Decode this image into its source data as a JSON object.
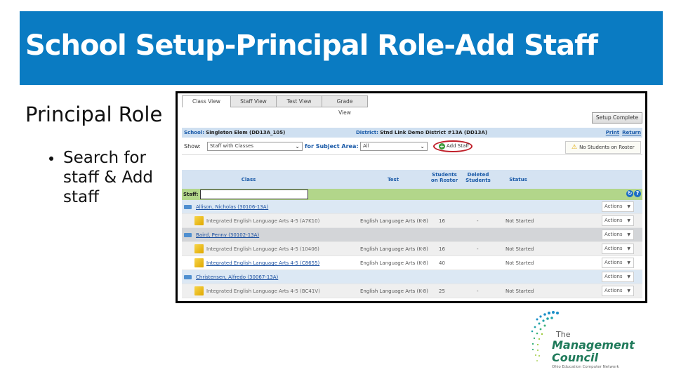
{
  "slide": {
    "title": "School Setup-Principal Role-Add Staff",
    "heading": "Principal Role",
    "bullets": [
      "Search for staff & Add staff"
    ],
    "accent_color": "#0a7bc2"
  },
  "app": {
    "tabs": [
      {
        "label": "Class View",
        "active": true
      },
      {
        "label": "Staff View",
        "active": false
      },
      {
        "label": "Test View",
        "active": false
      },
      {
        "label": "Grade View",
        "active": false
      }
    ],
    "setup_complete_label": "Setup Complete",
    "school_label": "School:",
    "school_value": "Singleton Elem (DD13A_105)",
    "district_label": "District:",
    "district_value": "Stnd Link Demo District #13A (DD13A)",
    "print_label": "Print",
    "return_label": "Return",
    "show_label": "Show:",
    "show_value": "Staff with Classes",
    "subject_label": "for Subject Area:",
    "subject_value": "All",
    "add_staff_label": "Add Staff",
    "no_students_label": "No Students on Roster",
    "columns": {
      "class": "Class",
      "test": "Test",
      "students_on_roster": "Students on Roster",
      "deleted_students": "Deleted Students",
      "status": "Status"
    },
    "staff_filter_label": "Staff:",
    "staff_filter_value": "",
    "actions_label": "Actions",
    "rows": [
      {
        "type": "staff",
        "name": "Allison, Nicholas (30106-13A)"
      },
      {
        "type": "class",
        "name": "Integrated English Language Arts 4-5 (A7K10)",
        "test": "English Language Arts (K-8)",
        "students": "16",
        "deleted": "-",
        "status": "Not Started"
      },
      {
        "type": "staff",
        "name": "Baird, Penny (30102-13A)"
      },
      {
        "type": "class",
        "name": "Integrated English Language Arts 4-5 (10406)",
        "test": "English Language Arts (K-8)",
        "students": "16",
        "deleted": "-",
        "status": "Not Started"
      },
      {
        "type": "class",
        "name": "Integrated English Language Arts 4-5 (C8655)",
        "test": "English Language Arts (K-8)",
        "students": "40",
        "deleted": "",
        "status": "Not Started"
      },
      {
        "type": "staff",
        "name": "Christensen, Alfredo (30067-13A)"
      },
      {
        "type": "class",
        "name": "Integrated English Language Arts 4-5 (BC41V)",
        "test": "English Language Arts (K-8)",
        "students": "25",
        "deleted": "-",
        "status": "Not Started"
      }
    ]
  },
  "logo": {
    "line1": "The",
    "line2": "Management",
    "line3": "Council",
    "tagline": "Ohio Education Computer Network"
  }
}
